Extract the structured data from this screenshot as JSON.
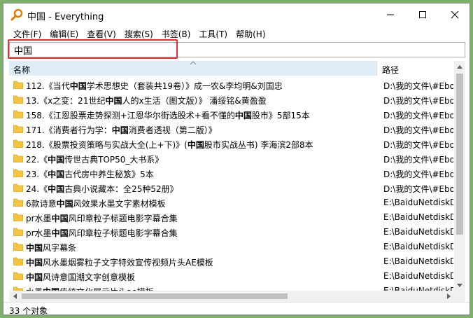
{
  "window": {
    "title": "中国 - Everything"
  },
  "menu": [
    "文件(F)",
    "编辑(E)",
    "查看(V)",
    "搜索(S)",
    "书签(B)",
    "工具(T)",
    "帮助(H)"
  ],
  "search": {
    "value": "中国",
    "placeholder": ""
  },
  "columns": {
    "name": "名称",
    "path": "路径"
  },
  "rows": [
    {
      "pre": "112.《当代",
      "bold": "中国",
      "post": "学术思想史（套装共19卷）》成一农&李均明&刘国忠",
      "path": "D:\\我的文件\\#Eboo"
    },
    {
      "pre": "13.《x之变：21世纪",
      "bold": "中国",
      "post": "人的x生活（图文版）》 潘绥铭&黄盈盈",
      "path": "D:\\我的文件\\#Eboo"
    },
    {
      "pre": "158.《江恩股票走势探测+江恩华尔街选股术+看不懂的",
      "bold": "中国",
      "post": "股市》5部15本",
      "path": "D:\\我的文件\\#Eboo"
    },
    {
      "pre": "171.《消费者行为学：",
      "bold": "中国",
      "post": "消费者透视（第二版）》",
      "path": "D:\\我的文件\\#Eboo"
    },
    {
      "pre": "218.《股票投资策略与实战大全(上+下)》(",
      "bold": "中国",
      "post": "股市实战丛书) 李海滨2部8本",
      "path": "D:\\我的文件\\#Eboo"
    },
    {
      "pre": "22.《",
      "bold": "中国",
      "post": "传世古典TOP50_大书系》",
      "path": "D:\\我的文件\\#Eboo"
    },
    {
      "pre": "23.《",
      "bold": "中国",
      "post": "古代房中养生秘笈》5本",
      "path": "D:\\我的文件\\#Eboo"
    },
    {
      "pre": "24.《",
      "bold": "中国",
      "post": "古典小说藏本：全25种52册》",
      "path": "D:\\我的文件\\#Eboo"
    },
    {
      "pre": "6款诗意",
      "bold": "中国",
      "post": "风效果水墨文字素材模板",
      "path": "E:\\BaiduNetdiskDo"
    },
    {
      "pre": "pr水墨",
      "bold": "中国",
      "post": "风印章粒子标题电影字幕合集",
      "path": "E:\\BaiduNetdiskDo"
    },
    {
      "pre": "pr水墨",
      "bold": "中国",
      "post": "风印章粒子标题电影字幕合集",
      "path": "E:\\BaiduNetdiskDo"
    },
    {
      "pre": "",
      "bold": "中国",
      "post": "风字幕条",
      "path": "E:\\BaiduNetdiskDo"
    },
    {
      "pre": "",
      "bold": "中国",
      "post": "风水墨烟雾粒子文字特效宣传视频片头AE模板",
      "path": "E:\\BaiduNetdiskDo"
    },
    {
      "pre": "",
      "bold": "中国",
      "post": "风诗意国潮文字创意模板",
      "path": "E:\\BaiduNetdiskDo"
    },
    {
      "pre": "水墨",
      "bold": "中国",
      "post": "传统文化展示片头ae模板",
      "path": "E:\\BaiduNetdiskDo"
    }
  ],
  "status": {
    "count": "33 个对象"
  },
  "colors": {
    "header_bg": "#dfedf9",
    "highlight_border": "#d93636",
    "folder": "#f5c542"
  }
}
